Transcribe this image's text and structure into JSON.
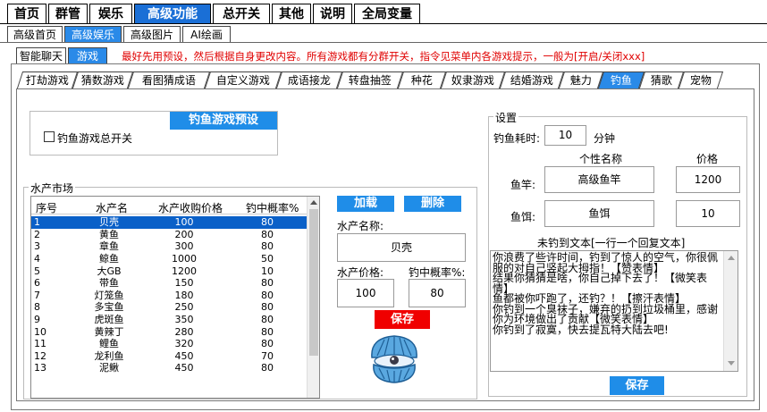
{
  "top_tabs": [
    "首页",
    "群管",
    "娱乐",
    "高级功能",
    "总开关",
    "其他",
    "说明",
    "全局变量"
  ],
  "sub_tabs": [
    "高级首页",
    "高级娱乐",
    "高级图片",
    "AI绘画"
  ],
  "third_tabs": [
    "智能聊天",
    "游戏"
  ],
  "notice": "最好先用预设，然后根据自身更改内容。所有游戏都有分群开关，指令见菜单内各游戏提示，一般为[开启/关闭xxx]",
  "game_tabs": [
    "打劫游戏",
    "猜数游戏",
    "看图猜成语",
    "自定义游戏",
    "成语接龙",
    "转盘抽签",
    "种花",
    "奴隶游戏",
    "结婚游戏",
    "魅力",
    "钓鱼",
    "猜歌",
    "宠物"
  ],
  "preset_button": "钓鱼游戏预设",
  "master_switch_label": "钓鱼游戏总开关",
  "market": {
    "title": "水产市场",
    "columns": [
      "序号",
      "水产名",
      "水产收购价格",
      "钓中概率%"
    ],
    "rows": [
      [
        "1",
        "贝壳",
        "100",
        "80"
      ],
      [
        "2",
        "黄鱼",
        "200",
        "80"
      ],
      [
        "3",
        "章鱼",
        "300",
        "80"
      ],
      [
        "4",
        "鲸鱼",
        "1000",
        "50"
      ],
      [
        "5",
        "大GB",
        "1200",
        "10"
      ],
      [
        "6",
        "带鱼",
        "150",
        "80"
      ],
      [
        "7",
        "灯笼鱼",
        "180",
        "80"
      ],
      [
        "8",
        "多宝鱼",
        "250",
        "80"
      ],
      [
        "9",
        "虎斑鱼",
        "350",
        "80"
      ],
      [
        "10",
        "黄辣丁",
        "280",
        "80"
      ],
      [
        "11",
        "鲤鱼",
        "320",
        "80"
      ],
      [
        "12",
        "龙利鱼",
        "450",
        "70"
      ],
      [
        "13",
        "泥鳅",
        "450",
        "80"
      ]
    ],
    "load_button": "加载",
    "delete_button": "删除",
    "name_label": "水产名称:",
    "name_value": "贝壳",
    "price_label": "水产价格:",
    "price_value": "100",
    "prob_label": "钓中概率%:",
    "prob_value": "80",
    "save_button": "保存"
  },
  "settings": {
    "title": "设置",
    "time_label": "钓鱼耗时:",
    "time_value": "10",
    "time_unit": "分钟",
    "name_header": "个性名称",
    "price_header": "价格",
    "rod_label": "鱼竿:",
    "rod_name": "高级鱼竿",
    "rod_price": "1200",
    "bait_label": "鱼饵:",
    "bait_name": "鱼饵",
    "bait_price": "10",
    "miss_title": "未钓到文本[一行一个回复文本]",
    "miss_text": "你浪费了些许时间，钓到了惊人的空气，你很佩服的对自己竖起大拇指！【赞表情】\n结果你猜猜是啥，你自己掉下去了！【微笑表情】\n鱼都被你吓跑了，还钓？！【擦汗表情】\n你钓到一个臭袜子，嫌弃的扔到垃圾桶里，感谢你为环境做出了贡献【微笑表情】\n你钓到了寂寞，快去提瓦特大陆去吧!",
    "save_button": "保存"
  },
  "colors": {
    "accent": "#1f8de8",
    "active_tab": "#1a6fd6",
    "danger": "#f00000",
    "notice": "#e00000"
  }
}
